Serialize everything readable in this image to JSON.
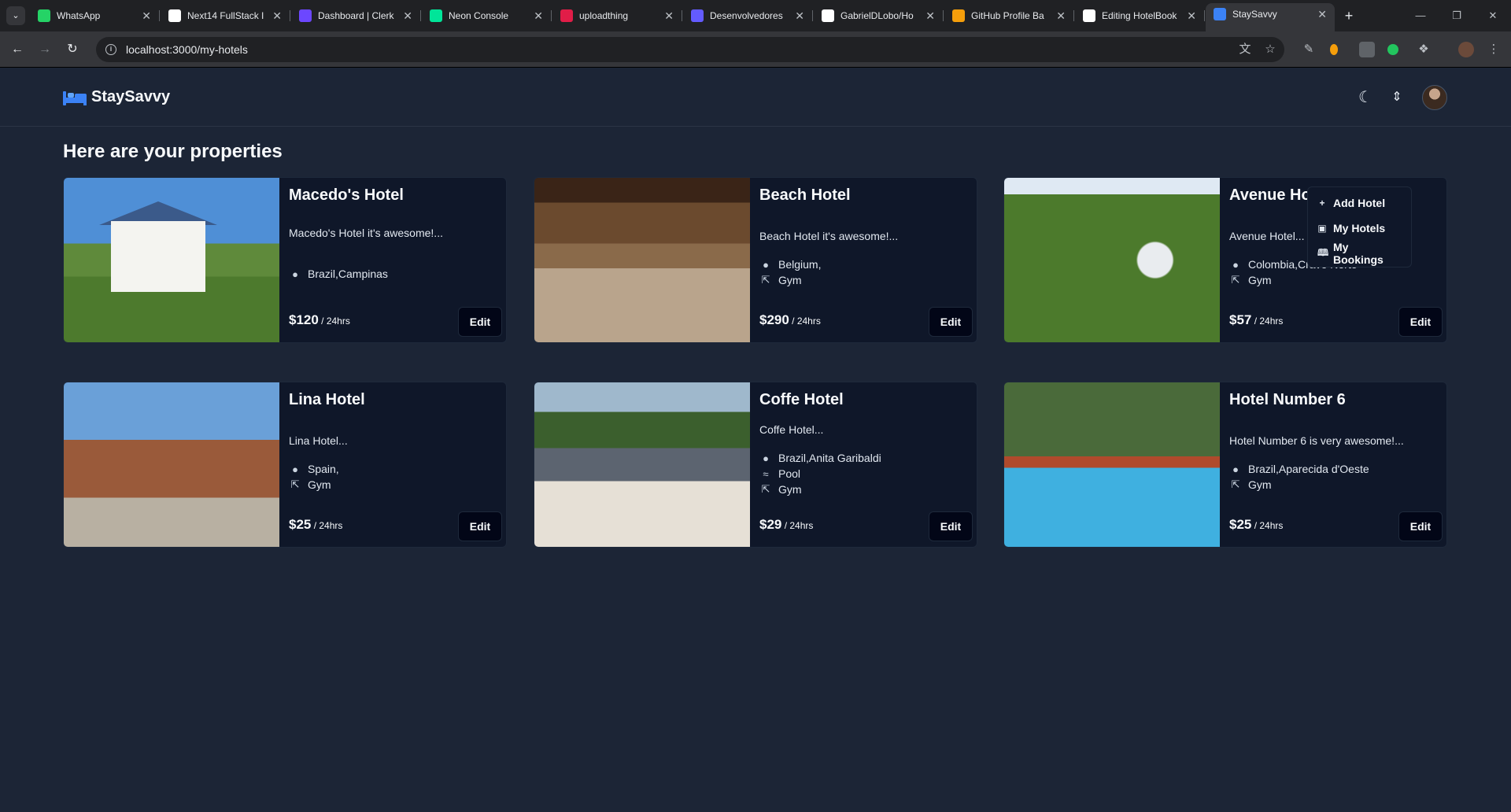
{
  "browser": {
    "tabs": [
      {
        "title": "WhatsApp",
        "favicon": "whatsapp-icon",
        "color": "#25d366"
      },
      {
        "title": "Next14 FullStack I",
        "favicon": "notion-icon",
        "color": "#ffffff"
      },
      {
        "title": "Dashboard | Clerk",
        "favicon": "clerk-icon",
        "color": "#6c47ff"
      },
      {
        "title": "Neon Console",
        "favicon": "neon-icon",
        "color": "#00e599"
      },
      {
        "title": "uploadthing",
        "favicon": "uploadthing-icon",
        "color": "#e11d48"
      },
      {
        "title": "Desenvolvedores",
        "favicon": "stripe-icon",
        "color": "#635bff"
      },
      {
        "title": "GabrielDLobo/Ho",
        "favicon": "github-icon",
        "color": "#ffffff"
      },
      {
        "title": "GitHub Profile Ba",
        "favicon": "octocat-icon",
        "color": "#f59e0b"
      },
      {
        "title": "Editing HotelBook",
        "favicon": "github-icon",
        "color": "#ffffff"
      },
      {
        "title": "StaySavvy",
        "favicon": "bed-icon",
        "color": "#3b82f6"
      }
    ],
    "url": "localhost:3000/my-hotels"
  },
  "app": {
    "brand": "StaySavvy",
    "page_title": "Here are your properties",
    "menu": [
      {
        "label": "Add Hotel",
        "icon": "plus-icon"
      },
      {
        "label": "My Hotels",
        "icon": "building-icon"
      },
      {
        "label": "My Bookings",
        "icon": "book-open-icon"
      }
    ],
    "hotels": [
      {
        "title": "Macedo's Hotel",
        "description": "Macedo's Hotel it's awesome!...",
        "features": [
          {
            "icon": "map-pin-icon",
            "text": "Brazil,Campinas"
          }
        ],
        "price": "$120",
        "per": " / 24hrs",
        "edit": "Edit"
      },
      {
        "title": "Beach Hotel",
        "description": "Beach Hotel it's awesome!...",
        "features": [
          {
            "icon": "map-pin-icon",
            "text": "Belgium,"
          },
          {
            "icon": "dumbbell-icon",
            "text": "Gym"
          }
        ],
        "price": "$290",
        "per": " / 24hrs",
        "edit": "Edit"
      },
      {
        "title": "Avenue Hotel",
        "description": "Avenue Hotel...",
        "features": [
          {
            "icon": "map-pin-icon",
            "text": "Colombia,Cravo Norte"
          },
          {
            "icon": "dumbbell-icon",
            "text": "Gym"
          }
        ],
        "price": "$57",
        "per": " / 24hrs",
        "edit": "Edit"
      },
      {
        "title": "Lina Hotel",
        "description": "Lina Hotel...",
        "features": [
          {
            "icon": "map-pin-icon",
            "text": "Spain,"
          },
          {
            "icon": "dumbbell-icon",
            "text": "Gym"
          }
        ],
        "price": "$25",
        "per": " / 24hrs",
        "edit": "Edit"
      },
      {
        "title": "Coffe Hotel",
        "description": "Coffe Hotel...",
        "features": [
          {
            "icon": "map-pin-icon",
            "text": "Brazil,Anita Garibaldi"
          },
          {
            "icon": "waves-icon",
            "text": "Pool"
          },
          {
            "icon": "dumbbell-icon",
            "text": "Gym"
          }
        ],
        "price": "$29",
        "per": " / 24hrs",
        "edit": "Edit"
      },
      {
        "title": "Hotel Number 6",
        "description": "Hotel Number 6 is very awesome!...",
        "features": [
          {
            "icon": "map-pin-icon",
            "text": "Brazil,Aparecida d'Oeste"
          },
          {
            "icon": "dumbbell-icon",
            "text": "Gym"
          }
        ],
        "price": "$25",
        "per": " / 24hrs",
        "edit": "Edit"
      }
    ]
  }
}
